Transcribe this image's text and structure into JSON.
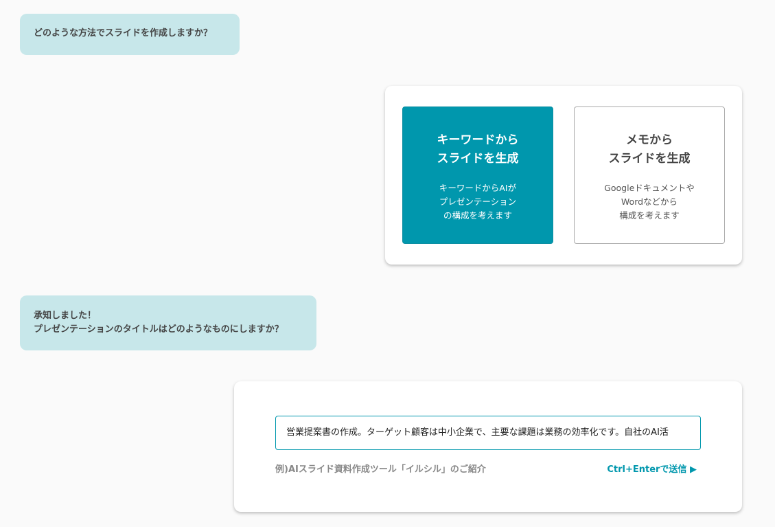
{
  "messages": [
    {
      "text": "どのような方法でスライドを作成しますか？"
    },
    {
      "line1": "承知しました！",
      "line2": "プレゼンテーションのタイトルはどのようなものにしますか？"
    }
  ],
  "options": [
    {
      "title": "キーワードから\nスライドを生成",
      "desc": "キーワードからAIが\nプレゼンテーション\nの構成を考えます",
      "selected": true
    },
    {
      "title": "メモから\nスライドを生成",
      "desc": "Googleドキュメントや\nWordなどから\n構成を考えます",
      "selected": false
    }
  ],
  "title_input": {
    "value": "営業提案書の作成。ターゲット顧客は中小企業で、主要な課題は業務の効率化です。自社のAI活",
    "hint": "例)AIスライド資料作成ツール「イルシル」のご紹介",
    "send_label": "Ctrl+Enterで送信 ▶"
  },
  "colors": {
    "accent": "#0097ad",
    "bubble": "#c7e7ea"
  }
}
